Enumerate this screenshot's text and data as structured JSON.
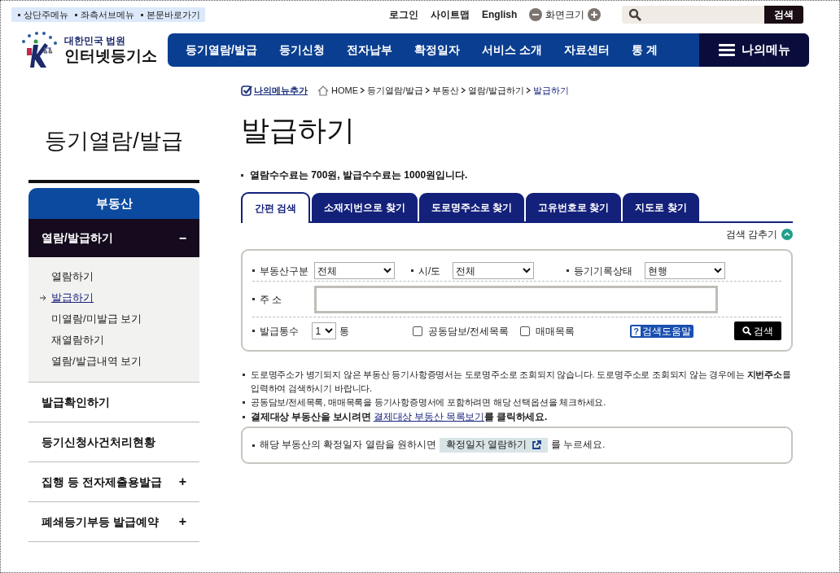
{
  "skip_links": [
    "상단주메뉴",
    "좌측서브메뉴",
    "본문바로가기"
  ],
  "top_links": [
    "로그인",
    "사이트맵",
    "English"
  ],
  "font_size": {
    "label": "화면크기"
  },
  "site_search": {
    "button": "검색"
  },
  "logo": {
    "org": "대한민국 법원",
    "name": "인터넷등기소"
  },
  "nav": {
    "items": [
      "등기열람/발급",
      "등기신청",
      "전자납부",
      "확정일자",
      "서비스 소개",
      "자료센터",
      "통 계"
    ],
    "my_menu": "나의메뉴"
  },
  "sidebar": {
    "title": "등기열람/발급",
    "section": "부동산",
    "items": [
      {
        "label": "열람/발급하기",
        "toggle": "−",
        "expanded": true,
        "children": [
          {
            "label": "열람하기",
            "selected": false
          },
          {
            "label": "발급하기",
            "selected": true
          },
          {
            "label": "미열람/미발급 보기",
            "selected": false
          },
          {
            "label": "재열람하기",
            "selected": false
          },
          {
            "label": "열람/발급내역 보기",
            "selected": false
          }
        ]
      },
      {
        "label": "발급확인하기",
        "expanded": false
      },
      {
        "label": "등기신청사건처리현황",
        "expanded": false
      },
      {
        "label": "집행 등 전자제출용발급",
        "toggle": "+",
        "expanded": false
      },
      {
        "label": "폐쇄등기부등 발급예약",
        "toggle": "+",
        "expanded": false
      }
    ]
  },
  "add_my_menu": "나의메뉴추가",
  "breadcrumb": [
    "HOME",
    "등기열람/발급",
    "부동산",
    "열람/발급하기",
    "발급하기"
  ],
  "page_title": "발급하기",
  "fee_notice": "열람수수료는 700원, 발급수수료는 1000원입니다.",
  "tabs": [
    {
      "label": "간편 검색",
      "selected": true
    },
    {
      "label": "소재지번으로 찾기",
      "selected": false
    },
    {
      "label": "도로명주소로 찾기",
      "selected": false
    },
    {
      "label": "고유번호로 찾기",
      "selected": false
    },
    {
      "label": "지도로 찾기",
      "selected": false
    }
  ],
  "hide_search": "검색 감추기",
  "form": {
    "property_type": {
      "label": "부동산구분",
      "value": "전체"
    },
    "region": {
      "label": "시/도",
      "value": "전체"
    },
    "record_status": {
      "label": "등기기록상태",
      "value": "현행"
    },
    "address": {
      "label": "주 소"
    },
    "copies": {
      "label": "발급통수",
      "value": "1",
      "unit": "통"
    },
    "options": [
      {
        "label": "공동담보/전세목록",
        "checked": false
      },
      {
        "label": "매매목록",
        "checked": false
      }
    ],
    "help": {
      "mark": "?",
      "label": "검색도움말"
    },
    "search_button": "검색"
  },
  "notes": [
    "도로명주소가 병기되지 않은 부동산 등기사항증명서는 도로명주소로 조회되지 않습니다. 도로명주소로 조회되지 않는 경우에는 **지번주소**를 입력하여 검색하시기 바랍니다.",
    "공동담보/전세목록, 매매목록을 등기사항증명서에 포함하려면 해당 선택옵션을 체크하세요."
  ],
  "settlement_note": {
    "before": "결제대상 부동산을 보시려면 ",
    "link": "결제대상 부동산 목록보기",
    "after": "를 클릭하세요."
  },
  "fixed_date_box": {
    "before": "해당 부동산의 확정일자 열람을 원하시면",
    "button": "확정일자 열람하기",
    "after": "를 누르세요."
  }
}
